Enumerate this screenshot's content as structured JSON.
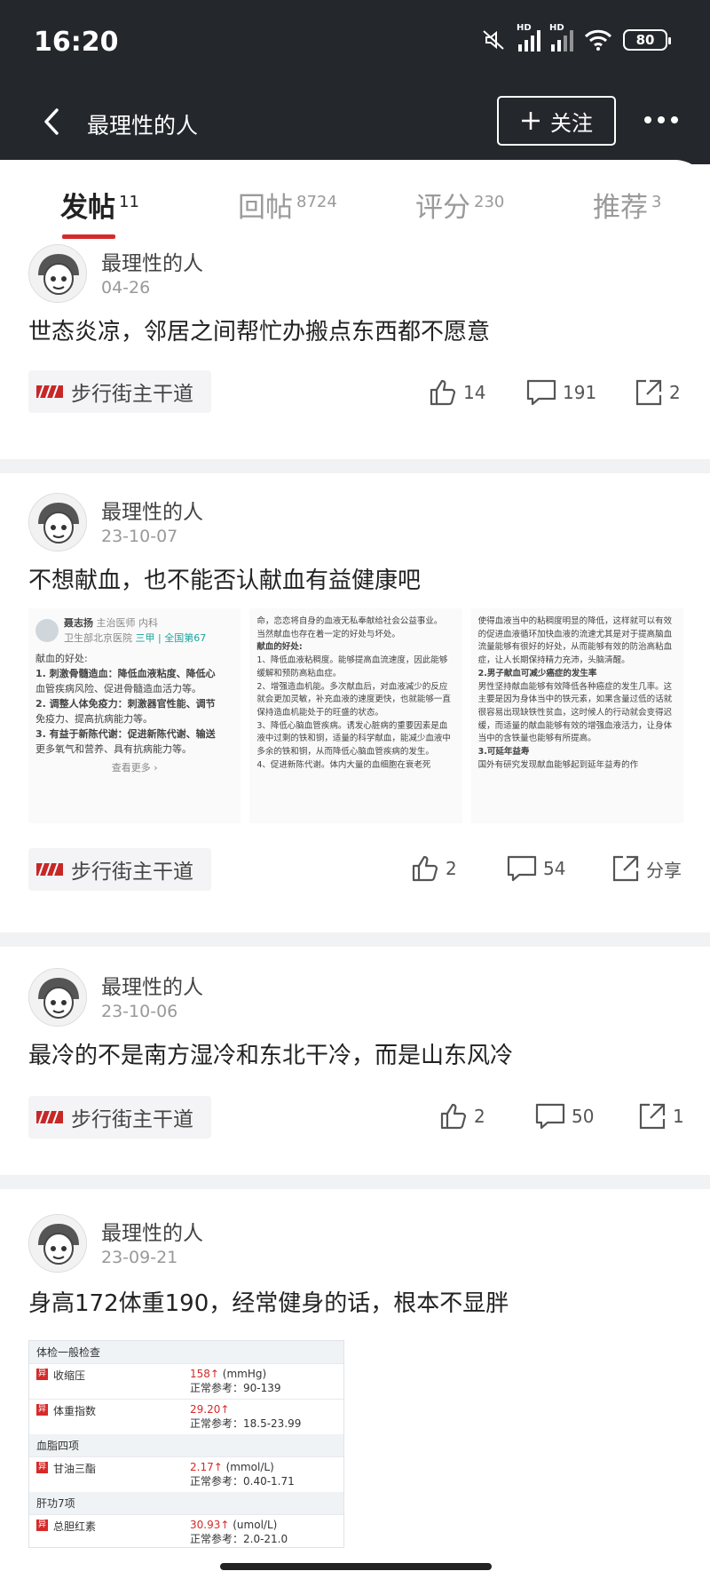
{
  "status_bar": {
    "time": "16:20",
    "signal1": "HD",
    "signal2": "HD",
    "battery": "80"
  },
  "nav": {
    "title": "最理性的人",
    "follow_label": "关注"
  },
  "tabs": [
    {
      "label": "发帖",
      "count": "11"
    },
    {
      "label": "回帖",
      "count": "8724"
    },
    {
      "label": "评分",
      "count": "230"
    },
    {
      "label": "推荐",
      "count": "3"
    }
  ],
  "posts": [
    {
      "author": "最理性的人",
      "date": "04-26",
      "title": "世态炎凉，邻居之间帮忙办搬点东西都不愿意",
      "tag": "步行街主干道",
      "likes": "14",
      "comments": "191",
      "shares": "2"
    },
    {
      "author": "最理性的人",
      "date": "23-10-07",
      "title": "不想献血，也不能否认献血有益健康吧",
      "tag": "步行街主干道",
      "likes": "2",
      "comments": "54",
      "shares": "分享"
    },
    {
      "author": "最理性的人",
      "date": "23-10-06",
      "title": "最冷的不是南方湿冷和东北干冷，而是山东风冷",
      "tag": "步行街主干道",
      "likes": "2",
      "comments": "50",
      "shares": "1"
    },
    {
      "author": "最理性的人",
      "date": "23-09-21",
      "title": "身高172体重190，经常健身的话，根本不显胖"
    }
  ],
  "img1": {
    "doctor": "聂志扬",
    "role": "主治医师 内科",
    "hospital": "卫生部北京医院",
    "badge": "三甲 | 全国第67",
    "intro": "献血的好处:",
    "lines": [
      "1. 刺激骨髓造血：降低血液粘度、降低心",
      "血管疾病风险、促进骨髓造血活力等。",
      "2. 调整人体免疫力：刺激器官性能、调节",
      "免疫力、提高抗病能力等。",
      "3. 有益于新陈代谢：促进新陈代谢、输送",
      "更多氧气和营养、具有抗病能力等。"
    ],
    "more": "查看更多 ›"
  },
  "img2": {
    "lines": [
      "命，恋恋将自身的血液无私奉献给社会公益事业。",
      "当然献血也存在着一定的好处与坏处。",
      "献血的好处:",
      "1、降低血液粘稠度。能够提高血流速度，因此能够缓解和预防高粘血症。",
      "2、增强造血机能。多次献血后，对血液减少的反应就会更加灵敏，补充血液的速度更快，也就能够一直保持造血机能处于的旺盛的状态。",
      "3、降低心脑血管疾病。诱发心脏病的重要因素是血液中过剩的铁和铜，适量的科学献血，能减少血液中多余的铁和铜，从而降低心脑血管疾病的发生。",
      "4、促进新陈代谢。体内大量的血细胞在衰老死"
    ]
  },
  "img3": {
    "lines": [
      "使得血液当中的粘稠度明显的降低，这样就可以有效的促进血液循环加快血液的流速尤其是对于提高脑血流量能够有很好的好处，从而能够有效的防治高粘血症，让人长期保持精力充沛，头脑清醒。",
      "2.男子献血可减少癌症的发生率",
      "男性坚持献血能够有效降低各种癌症的发生几率。这主要是因为身体当中的铁元素，如果含量过低的话就很容易出现缺铁性贫血，这时候人的行动就会变得迟缓，而适量的献血能够有效的增强血液活力，让身体当中的含铁量也能够有所提高。",
      "3.可延年益寿",
      "国外有研究发现献血能够起到延年益寿的作"
    ]
  },
  "report": {
    "section1": "体检一般检查",
    "row1": {
      "flag": "异",
      "name": "收缩压",
      "value": "158↑",
      "unit": "(mmHg)",
      "ref": "正常参考：90-139"
    },
    "row2": {
      "flag": "异",
      "name": "体重指数",
      "value": "29.20↑",
      "unit": "",
      "ref": "正常参考：18.5-23.99"
    },
    "section2": "血脂四项",
    "row3": {
      "flag": "异",
      "name": "甘油三酯",
      "value": "2.17↑",
      "unit": "(mmol/L)",
      "ref": "正常参考：0.40-1.71"
    },
    "section3": "肝功7项",
    "row4": {
      "flag": "异",
      "name": "总胆红素",
      "value": "30.93↑",
      "unit": "(umol/L)",
      "ref": "正常参考：2.0-21.0"
    }
  },
  "colors": {
    "accent": "#d62a2a",
    "dark_header": "#24272c"
  }
}
